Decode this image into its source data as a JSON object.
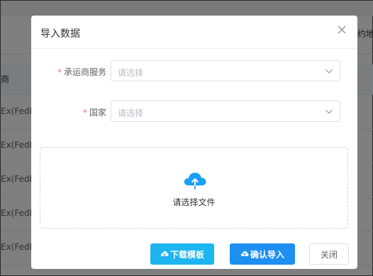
{
  "background": {
    "header_partial": "约地址",
    "column_partial": "商",
    "rows": [
      "Ex(FedEx",
      "Ex(FedEx",
      "Ex(FedEx",
      "Ex(FedEx",
      "Ex(FedEx"
    ]
  },
  "dialog": {
    "title": "导入数据",
    "fields": [
      {
        "label": "承运商服务",
        "required_mark": "*",
        "placeholder": "请选择"
      },
      {
        "label": "国家",
        "required_mark": "*",
        "placeholder": "请选择"
      }
    ],
    "upload_text": "请选择文件",
    "buttons": {
      "download": "下载模板",
      "import": "确认导入",
      "close": "关闭"
    }
  },
  "colors": {
    "accent_light": "#1cb5f0",
    "accent_primary": "#1d8ff0",
    "required": "#f56c6c",
    "upload_icon": "#1a9ff5"
  },
  "icons": [
    "close-icon",
    "chevron-down-icon",
    "cloud-upload-icon",
    "cloud-download-icon"
  ]
}
